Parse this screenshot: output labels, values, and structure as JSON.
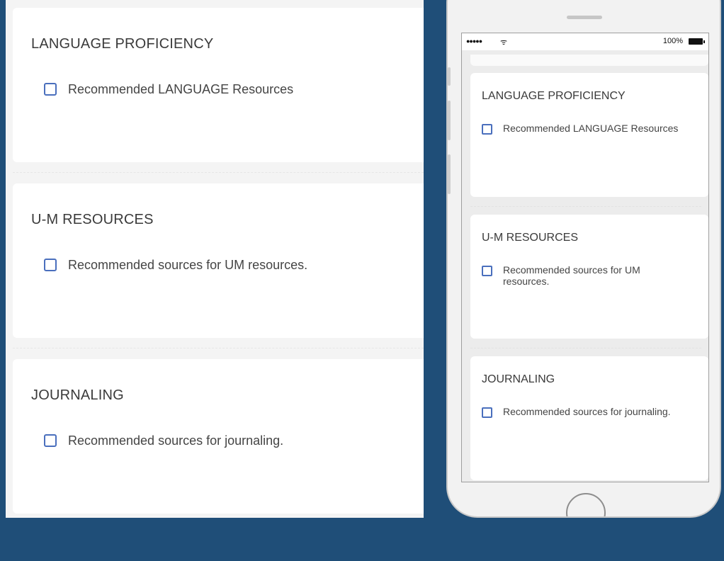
{
  "sections": [
    {
      "title": "LANGUAGE PROFICIENCY",
      "item": "Recommended LANGUAGE Resources"
    },
    {
      "title": "U-M RESOURCES",
      "item": "Recommended sources for UM resources."
    },
    {
      "title": "JOURNALING",
      "item": "Recommended sources for journaling."
    }
  ],
  "mobile": {
    "status": {
      "signal": "●●●●●",
      "wifi": "ᯤ",
      "battery": "100%"
    },
    "sections": [
      {
        "title": "LANGUAGE PROFICIENCY",
        "item": "Recommended LANGUAGE Resources"
      },
      {
        "title": "U-M RESOURCES",
        "item": "Recommended sources for UM resources."
      },
      {
        "title": "JOURNALING",
        "item": "Recommended sources for journaling."
      }
    ]
  },
  "colors": {
    "background": "#1f4e78",
    "checkbox_border": "#4a6fbd",
    "card": "#ffffff"
  },
  "icons": {
    "signal": "signal-dots-icon",
    "wifi": "wifi-icon",
    "battery": "battery-icon",
    "checkbox": "checkbox-icon",
    "home": "home-button-icon"
  }
}
